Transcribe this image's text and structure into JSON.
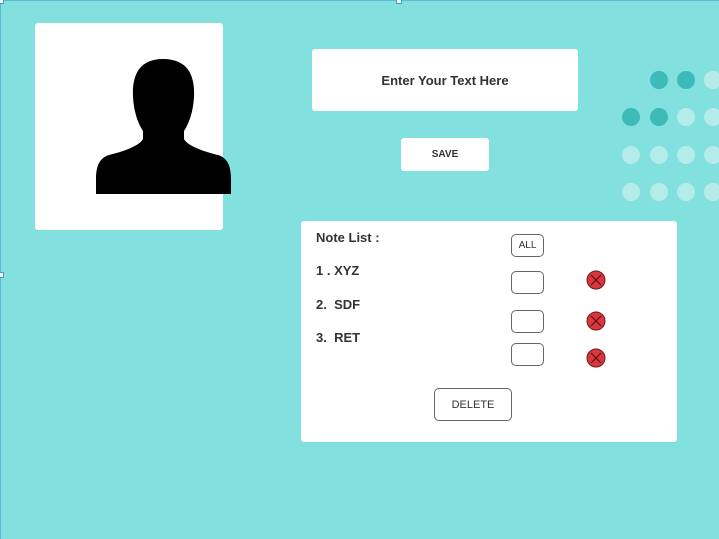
{
  "colors": {
    "background": "#82e0df",
    "dot_dark": "#3dbbb9",
    "dot_light": "#b4ecea",
    "delete_icon": "#d9363e"
  },
  "profile": {
    "icon": "user-silhouette-icon"
  },
  "text_input": {
    "placeholder": "Enter Your Text Here"
  },
  "save_button": {
    "label": "SAVE"
  },
  "notes": {
    "title": "Note List :",
    "all_label": "ALL",
    "items": [
      {
        "label": "1 . XYZ",
        "icon": "remove-circle-icon"
      },
      {
        "label": "2.  SDF",
        "icon": "remove-circle-icon"
      },
      {
        "label": "3.  RET",
        "icon": "remove-circle-icon"
      }
    ],
    "delete_label": "DELETE"
  }
}
